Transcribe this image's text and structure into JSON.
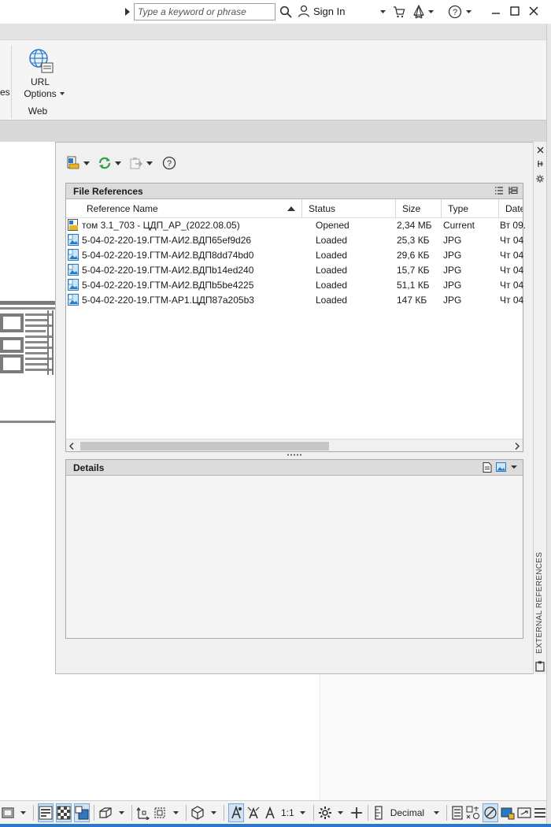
{
  "titlebar": {
    "search_placeholder": "Type a keyword or phrase",
    "sign_in": "Sign In"
  },
  "ribbon": {
    "partial_label": "es",
    "url_options_label_1": "URL",
    "url_options_label_2": "Options",
    "panel_label": "Web"
  },
  "palette": {
    "side_title": "EXTERNAL REFERENCES",
    "file_references": {
      "title": "File References",
      "columns": [
        "Reference Name",
        "Status",
        "Size",
        "Type",
        "Date"
      ],
      "rows": [
        {
          "name": "том 3.1_703 - ЦДП_АР_(2022.08.05)",
          "status": "Opened",
          "size": "2,34 МБ",
          "type": "Current",
          "date": "Вт 09."
        },
        {
          "name": "5-04-02-220-19.ГТМ-АИ2.ВДП65ef9d26",
          "status": "Loaded",
          "size": "25,3 КБ",
          "type": "JPG",
          "date": "Чт 04"
        },
        {
          "name": "5-04-02-220-19.ГТМ-АИ2.ВДП8dd74bd0",
          "status": "Loaded",
          "size": "29,6 КБ",
          "type": "JPG",
          "date": "Чт 04"
        },
        {
          "name": "5-04-02-220-19.ГТМ-АИ2.ВДПb14ed240",
          "status": "Loaded",
          "size": "15,7 КБ",
          "type": "JPG",
          "date": "Чт 04"
        },
        {
          "name": "5-04-02-220-19.ГТМ-АИ2.ВДПb5be4225",
          "status": "Loaded",
          "size": "51,1 КБ",
          "type": "JPG",
          "date": "Чт 04"
        },
        {
          "name": "5-04-02-220-19.ГТМ-АР1.ЦДП87a205b3",
          "status": "Loaded",
          "size": "147 КБ",
          "type": "JPG",
          "date": "Чт 04"
        }
      ]
    },
    "details": {
      "title": "Details"
    }
  },
  "statusbar": {
    "scale": "1:1",
    "units": "Decimal"
  },
  "colors": {
    "accent": "#2b78c5",
    "refresh_green": "#2aa14a"
  }
}
